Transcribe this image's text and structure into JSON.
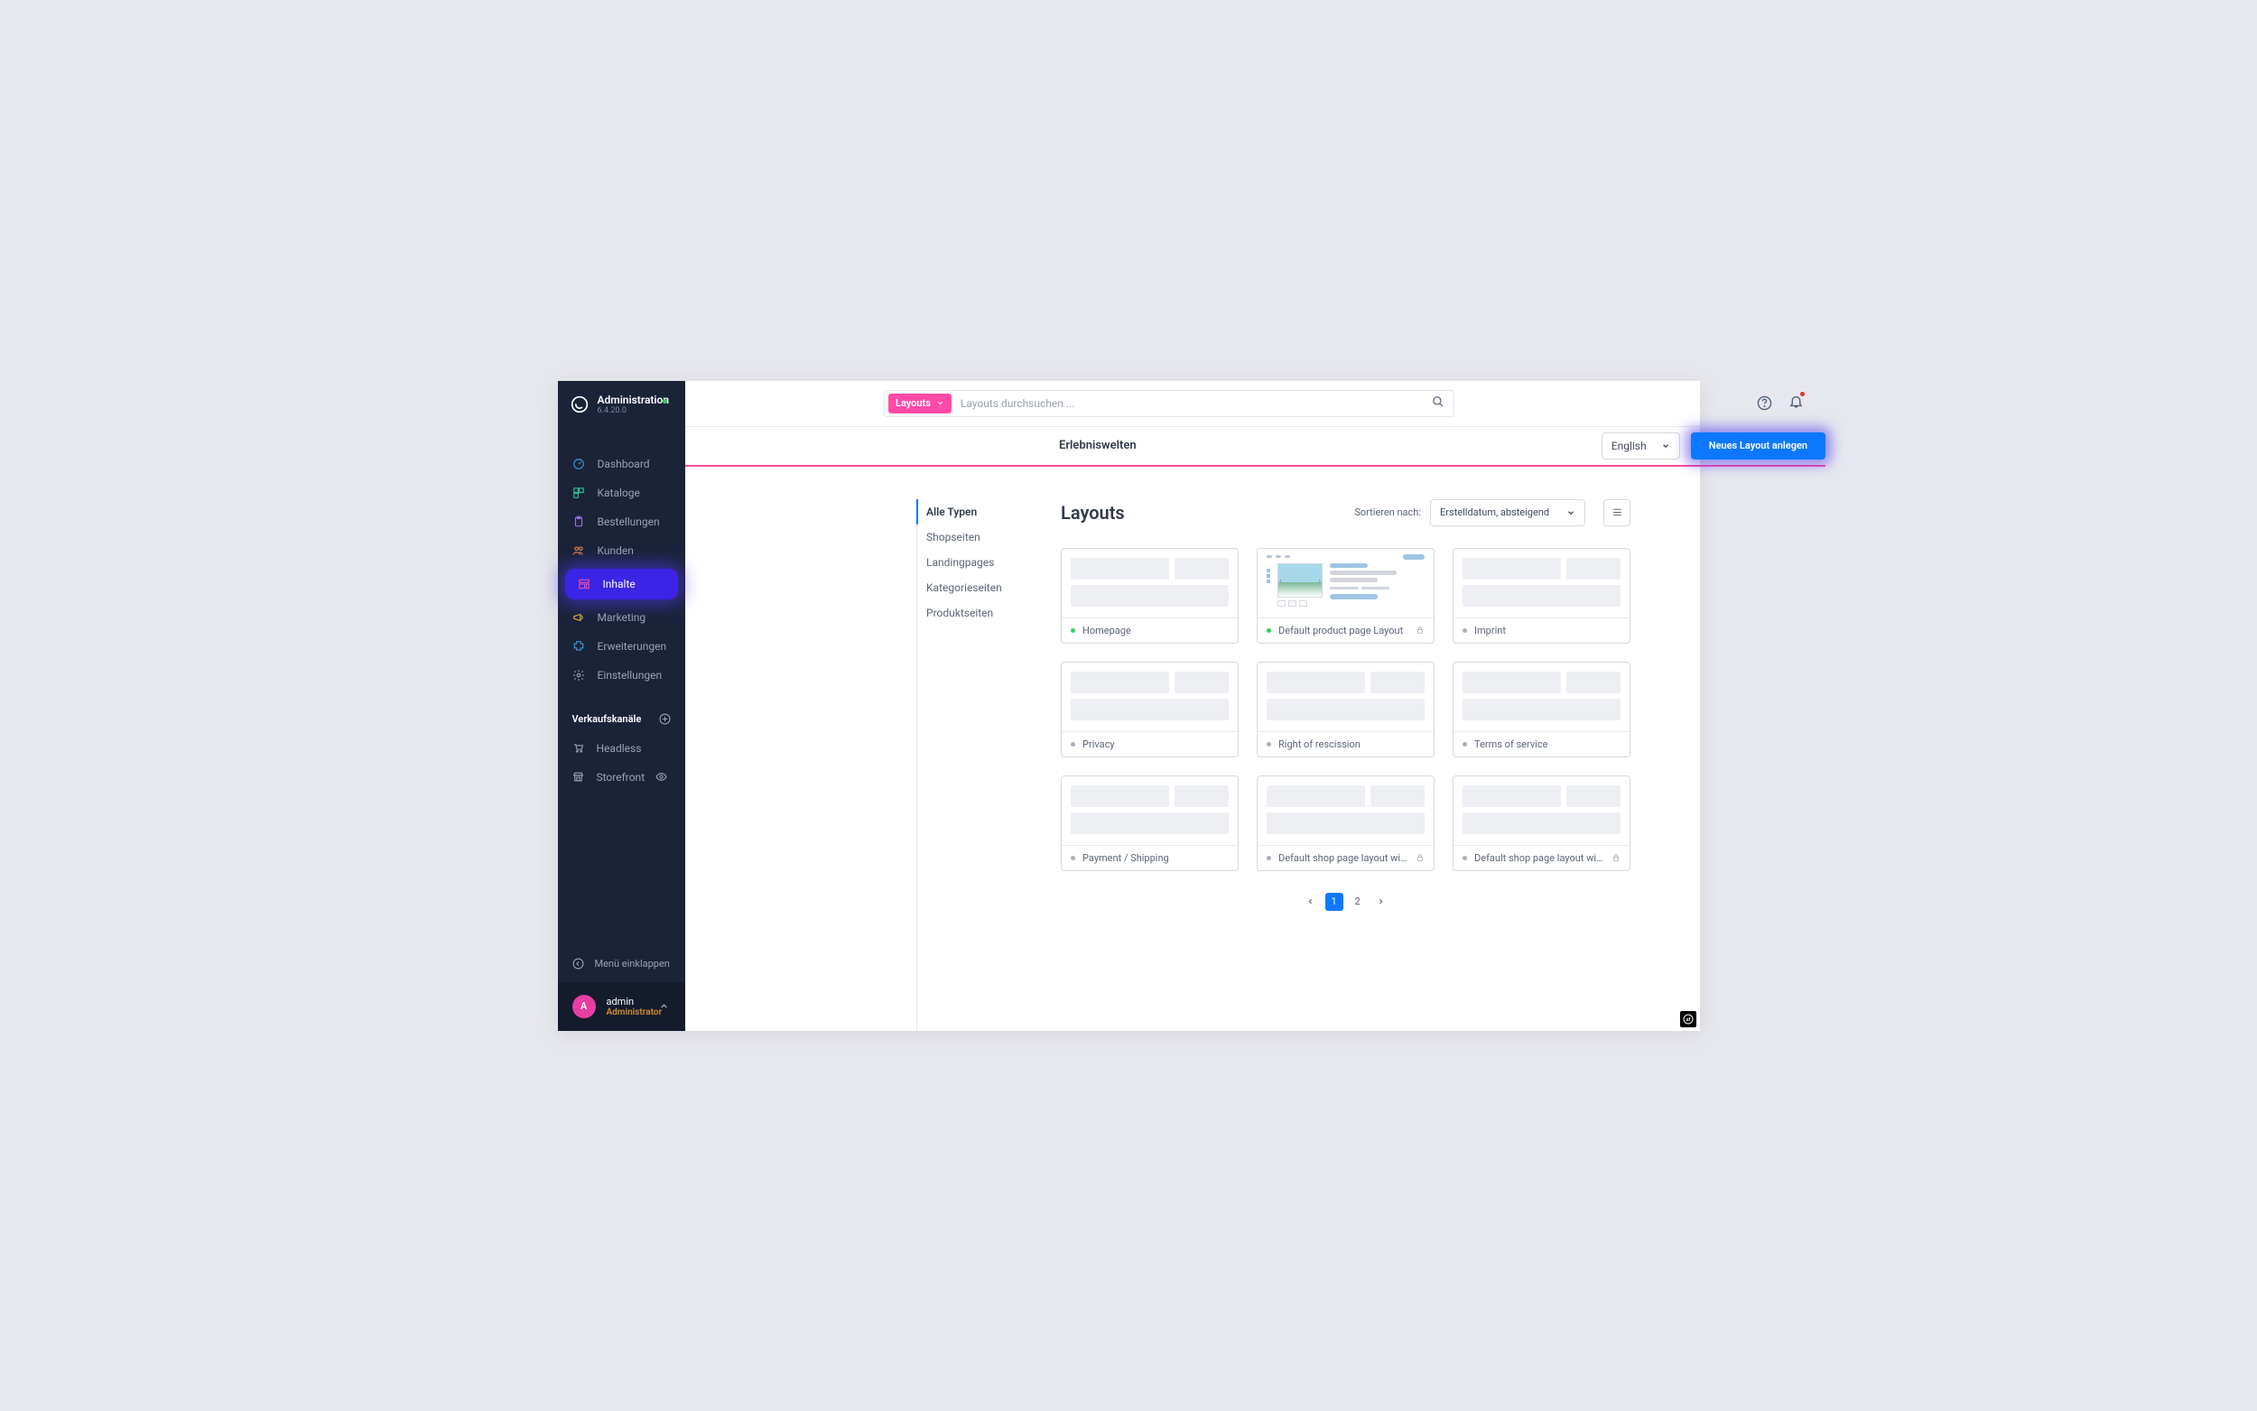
{
  "brand": {
    "title": "Administration",
    "version": "6.4.20.0"
  },
  "nav": [
    {
      "label": "Dashboard",
      "icon": "gauge",
      "color": "#3c97d6"
    },
    {
      "label": "Kataloge",
      "icon": "boxes",
      "color": "#2fb890"
    },
    {
      "label": "Bestellungen",
      "icon": "clipboard",
      "color": "#9b6ee0"
    },
    {
      "label": "Kunden",
      "icon": "users",
      "color": "#e77a4e"
    },
    {
      "label": "Inhalte",
      "icon": "layout",
      "color": "#e84e9c",
      "highlight": true
    },
    {
      "label": "Marketing",
      "icon": "megaphone",
      "color": "#e0b030"
    },
    {
      "label": "Erweiterungen",
      "icon": "puzzle",
      "color": "#3c97d6"
    },
    {
      "label": "Einstellungen",
      "icon": "gear",
      "color": "#9aa3b8"
    }
  ],
  "channels_section": "Verkaufskanäle",
  "channels": [
    {
      "label": "Headless",
      "icon": "cart"
    },
    {
      "label": "Storefront",
      "icon": "store",
      "eye": true
    }
  ],
  "collapse": "Menü einklappen",
  "user": {
    "initial": "A",
    "name": "admin",
    "role": "Administrator"
  },
  "search": {
    "tag": "Layouts",
    "placeholder": "Layouts durchsuchen ..."
  },
  "page": {
    "title": "Erlebniswelten",
    "lang": "English",
    "new_button": "Neues Layout anlegen"
  },
  "types": [
    "Alle Typen",
    "Shopseiten",
    "Landingpages",
    "Kategorieseiten",
    "Produktseiten"
  ],
  "types_active": 0,
  "list": {
    "title": "Layouts",
    "sort_label": "Sortieren nach:",
    "sort_value": "Erstelldatum, absteigend"
  },
  "cards": [
    {
      "name": "Homepage",
      "status": "green"
    },
    {
      "name": "Default product page Layout",
      "status": "green",
      "locked": true,
      "preview": "product"
    },
    {
      "name": "Imprint",
      "status": "grey"
    },
    {
      "name": "Privacy",
      "status": "grey"
    },
    {
      "name": "Right of rescission",
      "status": "grey"
    },
    {
      "name": "Terms of service",
      "status": "grey"
    },
    {
      "name": "Payment / Shipping",
      "status": "grey"
    },
    {
      "name": "Default shop page layout with newsle…",
      "status": "grey",
      "locked": true
    },
    {
      "name": "Default shop page layout with contac…",
      "status": "grey",
      "locked": true
    }
  ],
  "pager": {
    "pages": [
      "1",
      "2"
    ],
    "active": 0
  }
}
